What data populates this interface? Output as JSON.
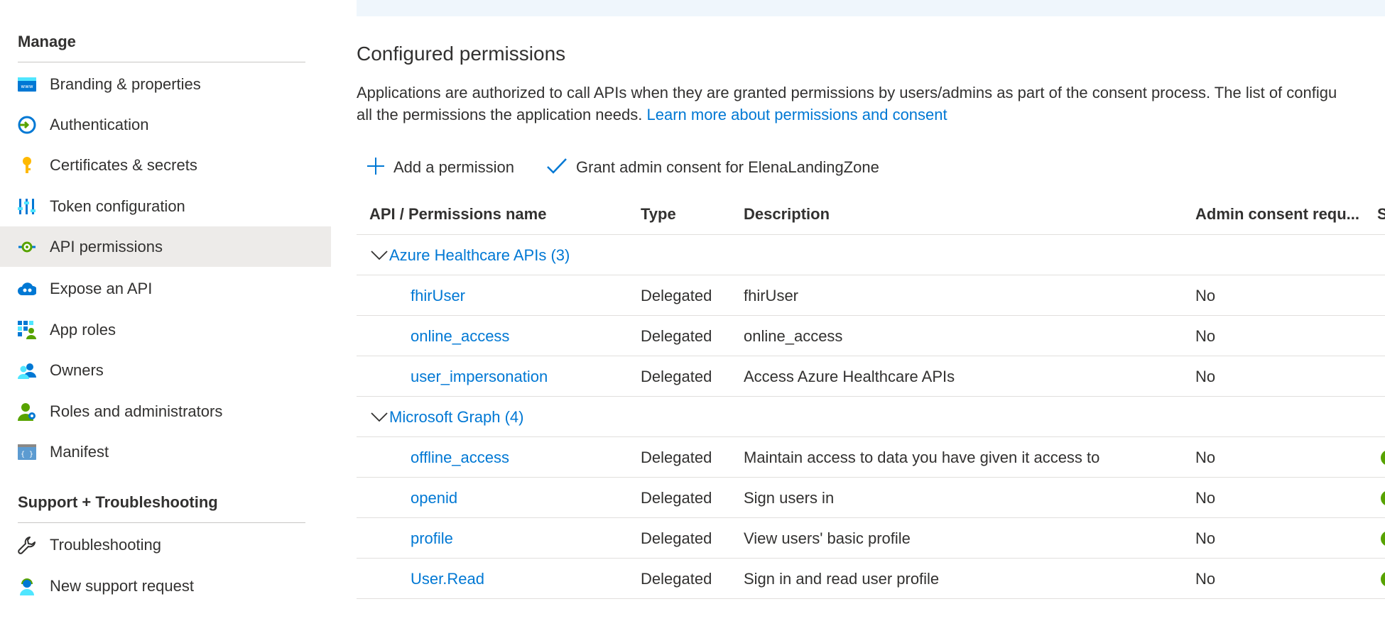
{
  "sidebar": {
    "manage_title": "Manage",
    "items": [
      {
        "label": "Branding & properties",
        "icon": "branding-icon"
      },
      {
        "label": "Authentication",
        "icon": "authentication-icon"
      },
      {
        "label": "Certificates & secrets",
        "icon": "key-icon"
      },
      {
        "label": "Token configuration",
        "icon": "token-config-icon"
      },
      {
        "label": "API permissions",
        "icon": "api-permissions-icon",
        "selected": true
      },
      {
        "label": "Expose an API",
        "icon": "cloud-api-icon"
      },
      {
        "label": "App roles",
        "icon": "app-roles-icon"
      },
      {
        "label": "Owners",
        "icon": "owners-icon"
      },
      {
        "label": "Roles and administrators",
        "icon": "roles-admin-icon"
      },
      {
        "label": "Manifest",
        "icon": "manifest-icon"
      }
    ],
    "support_title": "Support + Troubleshooting",
    "support_items": [
      {
        "label": "Troubleshooting",
        "icon": "wrench-icon"
      },
      {
        "label": "New support request",
        "icon": "support-agent-icon"
      }
    ]
  },
  "main": {
    "title": "Configured permissions",
    "description": "Applications are authorized to call APIs when they are granted permissions by users/admins as part of the consent process. The list of configu",
    "description_line2": "all the permissions the application needs.",
    "learn_more_link": "Learn more about permissions and consent",
    "commands": {
      "add_permission": "Add a permission",
      "grant_consent": "Grant admin consent for ElenaLandingZone"
    },
    "table": {
      "headers": {
        "name": "API / Permissions name",
        "type": "Type",
        "description": "Description",
        "admin_consent": "Admin consent requ...",
        "status": "S"
      },
      "groups": [
        {
          "label": "Azure Healthcare APIs (3)",
          "rows": [
            {
              "name": "fhirUser",
              "type": "Delegated",
              "description": "fhirUser",
              "admin_consent": "No",
              "granted": false
            },
            {
              "name": "online_access",
              "type": "Delegated",
              "description": "online_access",
              "admin_consent": "No",
              "granted": false
            },
            {
              "name": "user_impersonation",
              "type": "Delegated",
              "description": "Access Azure Healthcare APIs",
              "admin_consent": "No",
              "granted": false
            }
          ]
        },
        {
          "label": "Microsoft Graph (4)",
          "rows": [
            {
              "name": "offline_access",
              "type": "Delegated",
              "description": "Maintain access to data you have given it access to",
              "admin_consent": "No",
              "granted": true
            },
            {
              "name": "openid",
              "type": "Delegated",
              "description": "Sign users in",
              "admin_consent": "No",
              "granted": true
            },
            {
              "name": "profile",
              "type": "Delegated",
              "description": "View users' basic profile",
              "admin_consent": "No",
              "granted": true
            },
            {
              "name": "User.Read",
              "type": "Delegated",
              "description": "Sign in and read user profile",
              "admin_consent": "No",
              "granted": true
            }
          ]
        }
      ]
    }
  },
  "colors": {
    "link": "#0078d4",
    "selected_bg": "#edebe9",
    "granted_status": "#57a300",
    "info_bar": "#eff6fc"
  }
}
